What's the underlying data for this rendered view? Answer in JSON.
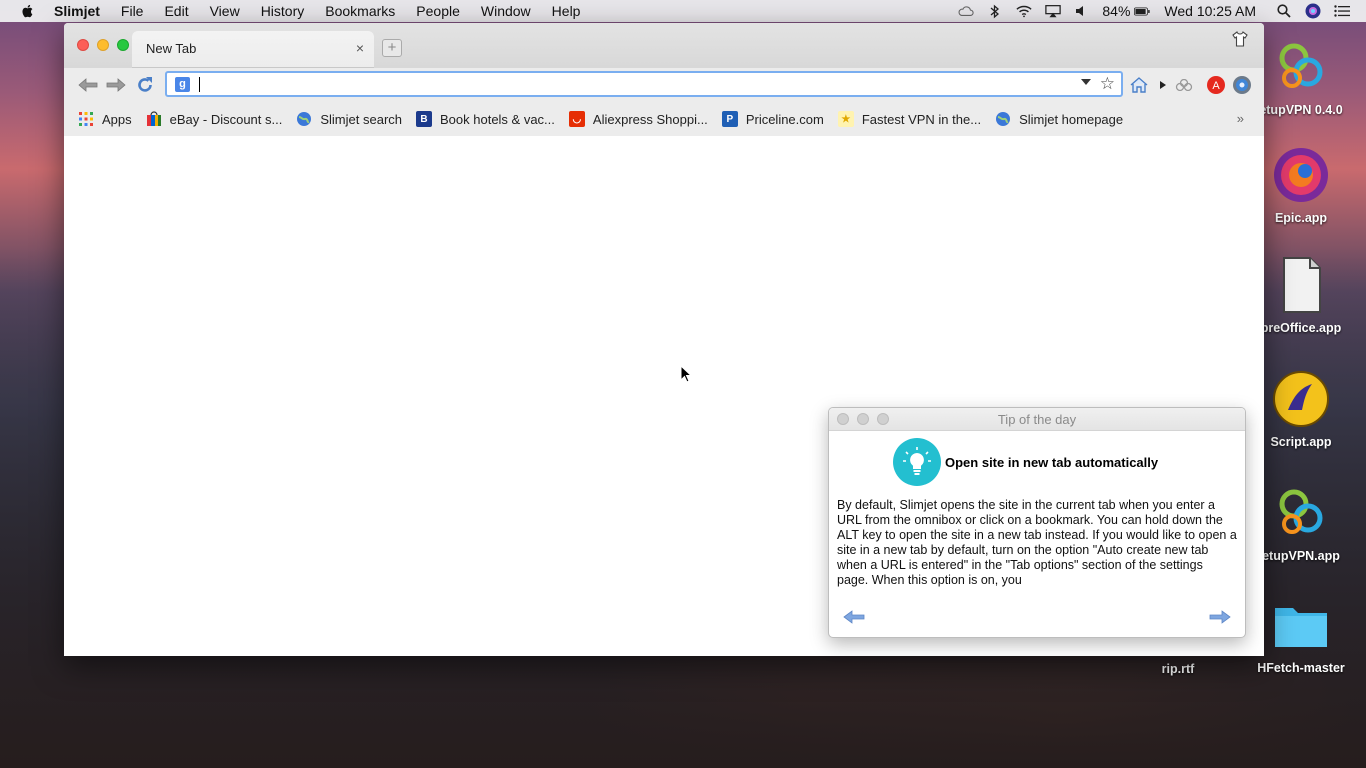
{
  "menubar": {
    "app_name": "Slimjet",
    "items": [
      "File",
      "Edit",
      "View",
      "History",
      "Bookmarks",
      "People",
      "Window",
      "Help"
    ],
    "battery": "84%",
    "clock": "Wed 10:25 AM"
  },
  "tab": {
    "title": "New Tab",
    "close": "×",
    "new_tab": "+"
  },
  "omnibox": {
    "value": "",
    "engine_badge": "g"
  },
  "bookmarks": {
    "items": [
      {
        "label": "Apps",
        "icon": "apps-grid-icon",
        "color": "#e0402f"
      },
      {
        "label": "eBay - Discount s...",
        "icon": "ebay-icon",
        "color": "#2a7a2a"
      },
      {
        "label": "Slimjet search",
        "icon": "globe-icon",
        "color": "#3b78d8"
      },
      {
        "label": "Book hotels & vac...",
        "icon": "booking-icon",
        "color": "#1b3a8c"
      },
      {
        "label": "Aliexpress Shoppi...",
        "icon": "aliexpress-icon",
        "color": "#e62e04"
      },
      {
        "label": "Priceline.com",
        "icon": "priceline-icon",
        "color": "#1f5fb5"
      },
      {
        "label": "Fastest VPN in the...",
        "icon": "vpn-star-icon",
        "color": "#f4c430"
      },
      {
        "label": "Slimjet homepage",
        "icon": "globe-icon",
        "color": "#3b78d8"
      }
    ],
    "more": "»"
  },
  "tip": {
    "window_title": "Tip of the day",
    "heading": "Open site in new tab automatically",
    "body": "By default, Slimjet opens the site in the current tab when you enter a URL from the omnibox or click on a bookmark. You can hold down the ALT key to open the site in a new tab instead. If you would like to open a site in a new tab by default, turn on the option \"Auto create new tab when a URL is entered\" in the \"Tab options\" section of the settings page. When this option is on, you"
  },
  "desktop": {
    "icons": [
      {
        "label": "etupVPN 0.4.0",
        "icon": "setupvpn-icon"
      },
      {
        "label": "Epic.app",
        "icon": "epic-browser-icon"
      },
      {
        "label": "breOffice.app",
        "icon": "document-icon"
      },
      {
        "label": "Script.app",
        "icon": "script-app-icon"
      },
      {
        "label": "etupVPN.app",
        "icon": "setupvpn-icon"
      },
      {
        "label": "HFetch-master",
        "icon": "folder-icon"
      },
      {
        "label": "rip.rtf",
        "icon": "rtf-file-icon"
      }
    ]
  },
  "colors": {
    "accent": "#4a86e8",
    "tip_bulb": "#23bfd0"
  }
}
